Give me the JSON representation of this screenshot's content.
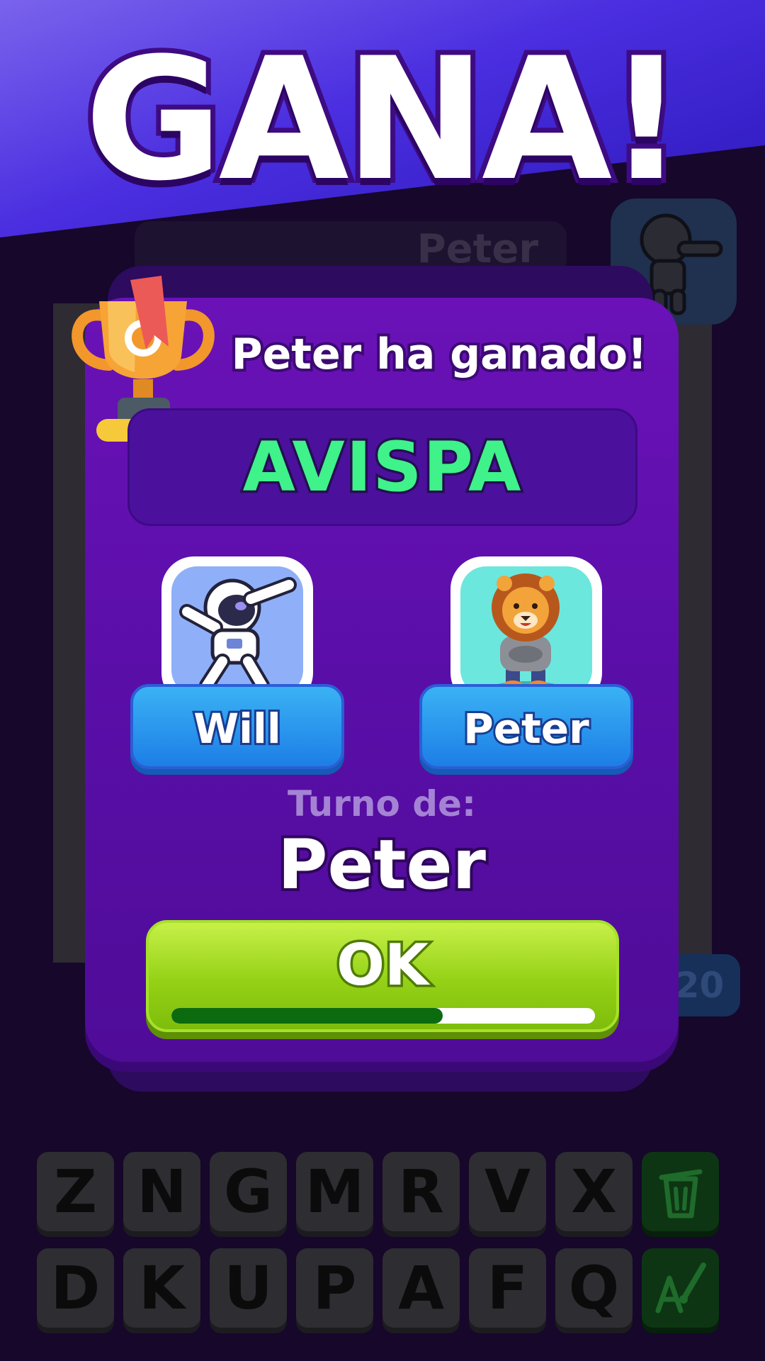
{
  "banner": {
    "title": "GANA!"
  },
  "background_screen": {
    "current_player": "Peter",
    "timer": "20",
    "keyboard": {
      "rows": [
        [
          "Z",
          "N",
          "G",
          "M",
          "R",
          "V",
          "X"
        ],
        [
          "D",
          "K",
          "U",
          "P",
          "A",
          "F",
          "Q"
        ]
      ],
      "actions": [
        "trash-icon",
        "font-brush-icon"
      ]
    }
  },
  "modal": {
    "winner_text": "Peter ha ganado!",
    "word": "AVISPA",
    "players": [
      {
        "name": "Will",
        "avatar": "astronaut-avatar",
        "avatar_bg": "#8fb0f8"
      },
      {
        "name": "Peter",
        "avatar": "lion-avatar",
        "avatar_bg": "#6ce7de"
      }
    ],
    "turn_label": "Turno de:",
    "turn_player": "Peter",
    "ok_label": "OK",
    "timer_progress": 0.64
  },
  "colors": {
    "word": "#3ff28a",
    "modal": "#5a0ea8",
    "ok_button": "#94d116",
    "player_button": "#2a8ff0"
  }
}
